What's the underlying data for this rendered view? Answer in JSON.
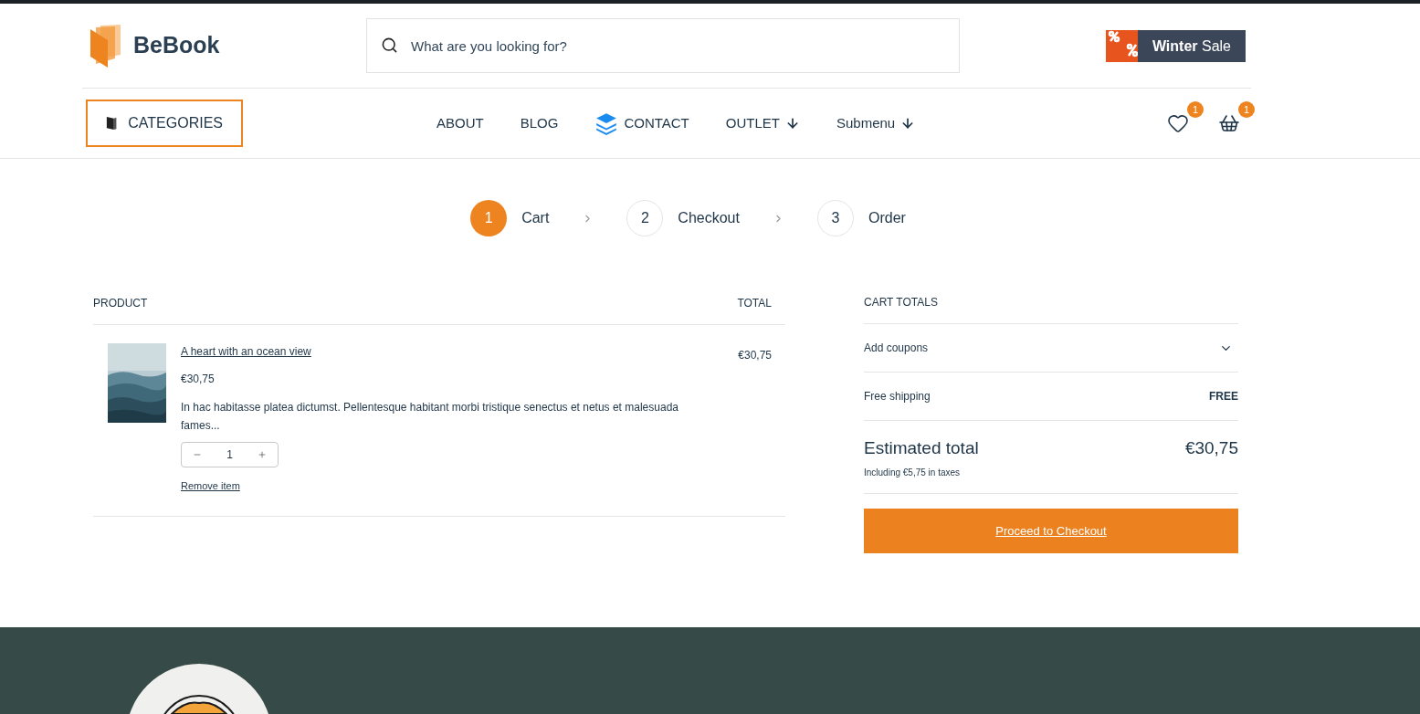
{
  "header": {
    "logo": "BeBook",
    "search": {
      "placeholder": "What are you looking for?"
    },
    "promo": "**Winter** Sale"
  },
  "nav": {
    "categories": "CATEGORIES",
    "items": [
      {
        "label": "ABOUT",
        "kind": "plain"
      },
      {
        "label": "BLOG",
        "kind": "plain"
      },
      {
        "label": "CONTACT",
        "kind": "featured"
      },
      {
        "label": "OUTLET",
        "kind": "dropdown"
      },
      {
        "label": "Submenu",
        "kind": "dropdown"
      }
    ],
    "wishlist_count": "1",
    "cart_count": "1"
  },
  "steps": [
    {
      "number": "1",
      "label": "Cart",
      "selected": true
    },
    {
      "number": "2",
      "label": "Checkout",
      "selected": false
    },
    {
      "number": "3",
      "label": "Order",
      "selected": false
    }
  ],
  "cart": {
    "columns": [
      "PRODUCT",
      "TOTAL"
    ],
    "items": [
      {
        "title": "A heart with an ocean view",
        "price": "€30,75",
        "description": "In hac habitasse platea dictumst. Pellentesque habitant morbi tristique senectus et netus et malesuada fames...",
        "quantity": "1",
        "remove": "Remove item",
        "total": "€30,75"
      }
    ]
  },
  "totals": {
    "title": "CART TOTALS",
    "coupons": {
      "label": "Add coupons",
      "expanded": false
    },
    "shipping": {
      "label": "Free shipping",
      "value": "FREE"
    },
    "estimated": {
      "label": "Estimated total",
      "value": "€30,75",
      "note": "Including €5,75 in taxes"
    },
    "checkout": "Proceed to Checkout"
  }
}
